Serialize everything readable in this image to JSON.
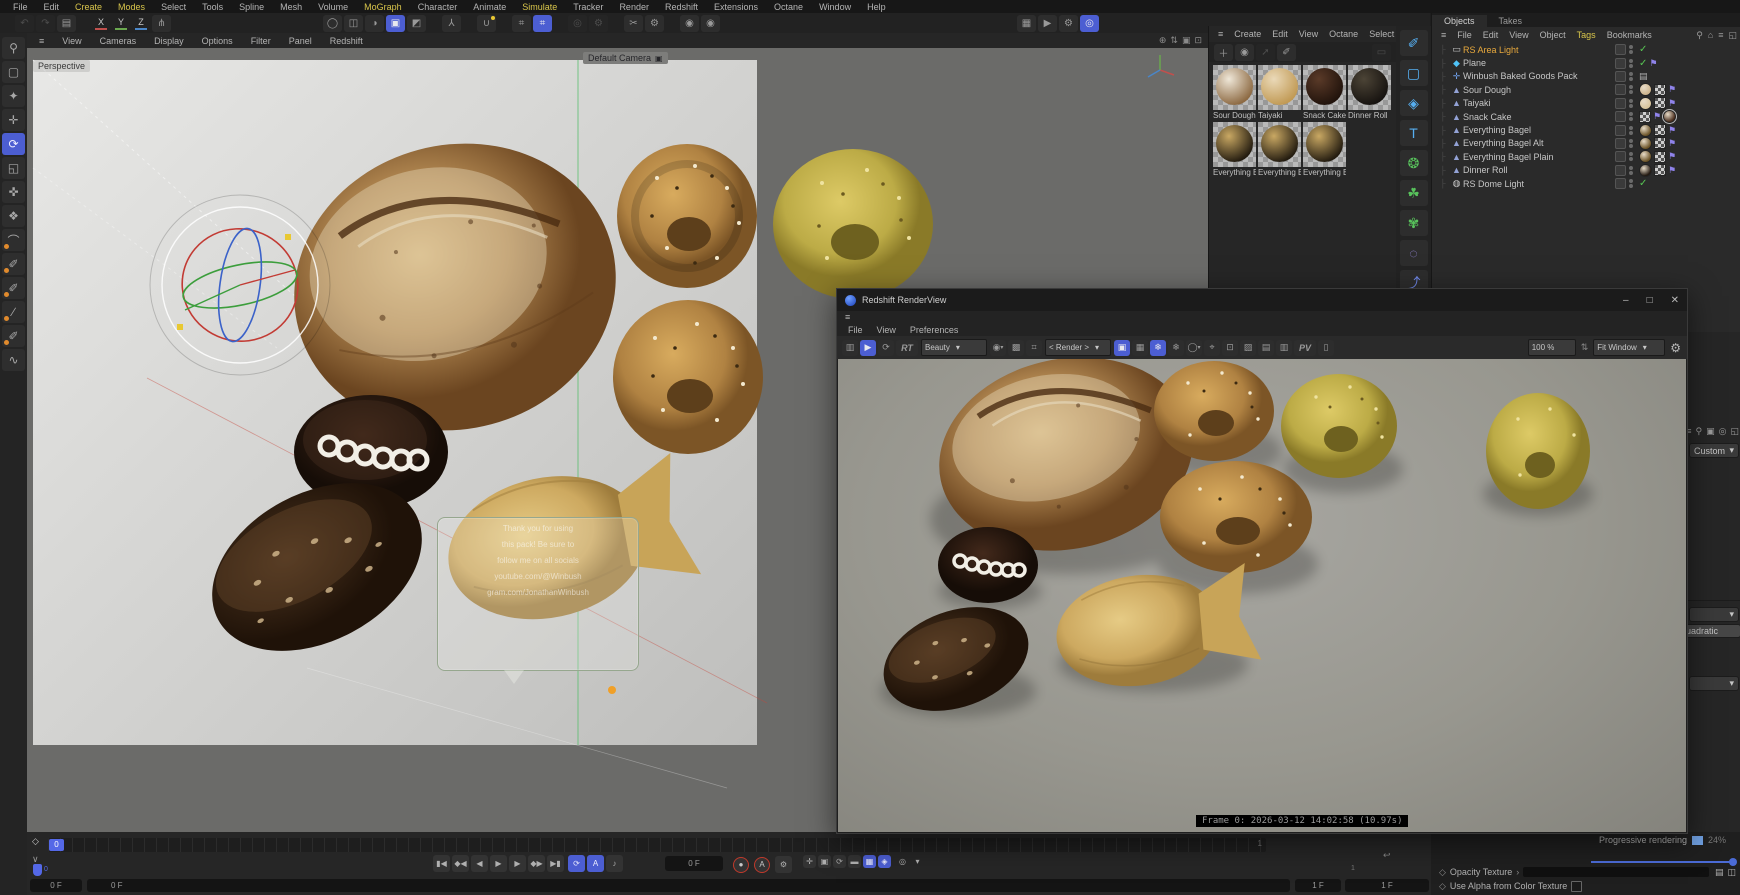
{
  "menubar": {
    "items": [
      {
        "label": "File"
      },
      {
        "label": "Edit"
      },
      {
        "label": "Create",
        "accent": true
      },
      {
        "label": "Modes",
        "accent": true
      },
      {
        "label": "Select"
      },
      {
        "label": "Tools"
      },
      {
        "label": "Spline"
      },
      {
        "label": "Mesh"
      },
      {
        "label": "Volume"
      },
      {
        "label": "MoGraph",
        "accent": true
      },
      {
        "label": "Character"
      },
      {
        "label": "Animate"
      },
      {
        "label": "Simulate",
        "accent": true
      },
      {
        "label": "Tracker"
      },
      {
        "label": "Render"
      },
      {
        "label": "Redshift"
      },
      {
        "label": "Extensions"
      },
      {
        "label": "Octane"
      },
      {
        "label": "Window"
      },
      {
        "label": "Help"
      }
    ]
  },
  "toolbar": {
    "left_icons": [
      {
        "n": "undo-icon",
        "g": "↶",
        "dim": true
      },
      {
        "n": "redo-icon",
        "g": "↷",
        "dim": true
      },
      {
        "n": "content-browser-icon",
        "g": "▤"
      }
    ],
    "xyz": [
      {
        "label": "X",
        "color": "#c0504d"
      },
      {
        "label": "Y",
        "color": "#6aa84f"
      },
      {
        "label": "Z",
        "color": "#4a86c8"
      }
    ],
    "coord_icon": {
      "n": "coordinate-system-icon",
      "g": "⋔"
    },
    "center_icons": [
      {
        "n": "make-editable-icon",
        "g": "◯"
      },
      {
        "n": "model-mode-icon",
        "g": "◫"
      },
      {
        "n": "texture-mode-icon",
        "g": "◑"
      },
      {
        "n": "object-mode-icon",
        "g": "▣",
        "active": true
      },
      {
        "n": "animation-mode-icon",
        "g": "◩"
      },
      {
        "sp": true
      },
      {
        "n": "character-tools-icon",
        "g": "⅄"
      },
      {
        "sp": true
      },
      {
        "n": "snap-icon",
        "g": "∪",
        "dot": "#e8c832"
      },
      {
        "sp": true
      },
      {
        "n": "workplane-icon",
        "g": "⌗"
      },
      {
        "n": "grid-snap-icon",
        "g": "⌗",
        "active": true
      },
      {
        "sp": true
      },
      {
        "n": "disabled-tool-icon",
        "g": "◎",
        "dim": true
      },
      {
        "n": "disabled-gear-icon",
        "g": "⚙",
        "dim": true
      },
      {
        "sp": true
      },
      {
        "n": "mirror-icon",
        "g": "✂"
      },
      {
        "n": "mirror-gear-icon",
        "g": "⚙"
      },
      {
        "sp": true
      },
      {
        "n": "axis-lock-icon",
        "g": "◉"
      },
      {
        "n": "axis-center-icon",
        "g": "◉"
      }
    ],
    "right_icons": [
      {
        "n": "render-view-icon",
        "g": "▦"
      },
      {
        "n": "render-pv-icon",
        "g": "▶"
      },
      {
        "n": "render-settings-icon",
        "g": "⚙"
      },
      {
        "n": "octane-live-icon",
        "g": "◎",
        "active": true
      }
    ]
  },
  "left_tools": [
    {
      "n": "search-icon",
      "g": "⚲"
    },
    {
      "n": "live-selection-icon",
      "g": "▢"
    },
    {
      "n": "tweak-icon",
      "g": "✦"
    },
    {
      "n": "move-icon",
      "g": "✛"
    },
    {
      "n": "rotate-icon",
      "g": "⟳",
      "active": true
    },
    {
      "n": "scale-icon",
      "g": "◱"
    },
    {
      "n": "axis-move-icon",
      "g": "✜"
    },
    {
      "n": "axis-modify-icon",
      "g": "❖"
    },
    {
      "n": "spline-smooth-icon",
      "g": "⌒",
      "o": true
    },
    {
      "n": "spline-pen-icon",
      "g": "✐",
      "o": true
    },
    {
      "n": "spline-point-icon",
      "g": "✐",
      "o": true
    },
    {
      "n": "measure-icon",
      "g": "∕",
      "o": true
    },
    {
      "n": "spline-arc-icon",
      "g": "✐",
      "o": true
    },
    {
      "n": "sketch-icon",
      "g": "∿"
    }
  ],
  "viewport": {
    "menu": [
      "View",
      "Cameras",
      "Display",
      "Options",
      "Filter",
      "Panel",
      "Redshift"
    ],
    "corner_icons": [
      {
        "n": "vp-pin-icon",
        "g": "⊕"
      },
      {
        "n": "vp-swap-icon",
        "g": "⇅"
      },
      {
        "n": "vp-maximize-icon",
        "g": "▣"
      },
      {
        "n": "vp-layout-icon",
        "g": "⊡"
      }
    ],
    "perspective_label": "Perspective",
    "camera_label": "Default Camera",
    "annotation_lines": [
      "Thank you for using",
      "this pack! Be sure to",
      "follow me on all socials",
      "youtube.com/@Winbush",
      "gram.com/JonathanWinbush"
    ]
  },
  "materials": {
    "menu": [
      "Create",
      "Edit",
      "View",
      "Octane",
      "Select",
      "›"
    ],
    "tools": [
      {
        "n": "add-material-icon",
        "g": "＋"
      },
      {
        "n": "material-ball-icon",
        "g": "◉"
      },
      {
        "n": "load-material-icon",
        "g": "➚",
        "dim": true
      },
      {
        "n": "eyedropper-icon",
        "g": "✐"
      }
    ],
    "trash_icon": {
      "n": "trash-icon",
      "g": "▭"
    },
    "items": [
      {
        "label": "Sour Dough",
        "hi": "#efe7d8",
        "lo": "#8d6a43"
      },
      {
        "label": "Taiyaki",
        "hi": "#ead9b8",
        "lo": "#c19a55"
      },
      {
        "label": "Snack Cake",
        "hi": "#5a3a28",
        "lo": "#21130c"
      },
      {
        "label": "Dinner Roll",
        "hi": "#4c4436",
        "lo": "#171310"
      },
      {
        "label": "Everything B",
        "hi": "#c9a863",
        "lo": "#241c10"
      },
      {
        "label": "Everything B",
        "hi": "#c9a863",
        "lo": "#241c10"
      },
      {
        "label": "Everything B",
        "hi": "#c9a863",
        "lo": "#241c10"
      }
    ]
  },
  "icon_strip": [
    {
      "n": "spline-pen-tool-icon",
      "g": "✐",
      "c": "#56aef0"
    },
    {
      "n": "rectangle-spline-icon",
      "g": "▢",
      "c": "#56aef0"
    },
    {
      "n": "cube-primitive-icon",
      "g": "◈",
      "c": "#56aef0"
    },
    {
      "n": "text-spline-icon",
      "g": "T",
      "c": "#56aef0"
    },
    {
      "n": "subdivision-surface-icon",
      "g": "❂",
      "c": "#58c25c"
    },
    {
      "n": "cloner-icon",
      "g": "☘",
      "c": "#58c25c"
    },
    {
      "n": "field-icon",
      "g": "✾",
      "c": "#58c25c"
    },
    {
      "n": "bend-deformer-icon",
      "g": "◌",
      "c": "#9a8ae0"
    },
    {
      "n": "xpresso-icon",
      "g": "⤴",
      "c": "#6f87e8"
    },
    {
      "n": "sound-icon",
      "g": "♪",
      "c": "#d07ad0"
    }
  ],
  "objects_panel": {
    "tabs": [
      {
        "label": "Objects",
        "on": true
      },
      {
        "label": "Takes"
      }
    ],
    "menu": [
      {
        "label": "File"
      },
      {
        "label": "Edit"
      },
      {
        "label": "View"
      },
      {
        "label": "Object"
      },
      {
        "label": "Tags",
        "accent": true
      },
      {
        "label": "Bookmarks"
      }
    ],
    "menu_icons": [
      {
        "n": "search-icon",
        "g": "⚲"
      },
      {
        "n": "home-icon",
        "g": "⌂"
      },
      {
        "n": "filter-icon",
        "g": "≡"
      },
      {
        "n": "popout-icon",
        "g": "◱"
      }
    ],
    "items": [
      {
        "label": "RS Area Light",
        "icon": "area-light",
        "color": "#e8a93d",
        "tags": [
          {
            "t": "check"
          }
        ]
      },
      {
        "label": "Plane",
        "icon": "plane",
        "tags": [
          {
            "t": "check"
          },
          {
            "t": "flag"
          }
        ]
      },
      {
        "label": "Winbush Baked Goods Pack",
        "icon": "null",
        "tags": [
          {
            "t": "note"
          }
        ]
      },
      {
        "label": "Sour Dough",
        "icon": "mesh",
        "tags": [
          {
            "t": "ball",
            "c": "#cdb48c"
          },
          {
            "t": "checker"
          },
          {
            "t": "flag"
          }
        ]
      },
      {
        "label": "Taiyaki",
        "icon": "mesh",
        "tags": [
          {
            "t": "ball",
            "c": "#d8c49b"
          },
          {
            "t": "checker"
          },
          {
            "t": "flag"
          }
        ]
      },
      {
        "label": "Snack Cake",
        "icon": "mesh",
        "tags": [
          {
            "t": "checker"
          },
          {
            "t": "flag"
          },
          {
            "t": "ball",
            "c": "#4a2e1e",
            "sel": true
          }
        ]
      },
      {
        "label": "Everything Bagel",
        "icon": "mesh",
        "tags": [
          {
            "t": "ball",
            "c": "#6b5327"
          },
          {
            "t": "checker"
          },
          {
            "t": "flag"
          }
        ]
      },
      {
        "label": "Everything Bagel Alt",
        "icon": "mesh",
        "tags": [
          {
            "t": "ball",
            "c": "#6b5327"
          },
          {
            "t": "checker"
          },
          {
            "t": "flag"
          }
        ]
      },
      {
        "label": "Everything Bagel  Plain",
        "icon": "mesh",
        "tags": [
          {
            "t": "ball",
            "c": "#6b5327"
          },
          {
            "t": "checker"
          },
          {
            "t": "flag"
          }
        ]
      },
      {
        "label": "Dinner Roll",
        "icon": "mesh",
        "tags": [
          {
            "t": "ball",
            "c": "#241a12"
          },
          {
            "t": "checker"
          },
          {
            "t": "flag"
          }
        ]
      },
      {
        "label": "RS Dome Light",
        "icon": "dome-light",
        "tags": [
          {
            "t": "check"
          }
        ]
      }
    ],
    "icon_glyphs": {
      "area-light": [
        "▭",
        "#c8c8c8"
      ],
      "plane": [
        "◆",
        "#4fc3f7"
      ],
      "null": [
        "✛",
        "#6f9fe8"
      ],
      "mesh": [
        "▲",
        "#93a2d6"
      ],
      "dome-light": [
        "◍",
        "#c8c8c8"
      ]
    }
  },
  "attr_sliver": {
    "icons": [
      {
        "n": "attr-mode-icon",
        "g": "≡"
      },
      {
        "n": "attr-search-icon",
        "g": "⚲"
      },
      {
        "n": "attr-lock-icon",
        "g": "▣"
      },
      {
        "n": "attr-target-icon",
        "g": "◎"
      },
      {
        "n": "attr-popout-icon",
        "g": "◱"
      }
    ],
    "custom": "Custom",
    "quadratic": "uadratic"
  },
  "renderview": {
    "title": "Redshift RenderView",
    "window_buttons": [
      {
        "n": "minimize-button",
        "g": "–"
      },
      {
        "n": "maximize-button",
        "g": "□"
      },
      {
        "n": "close-button",
        "g": "✕"
      }
    ],
    "menu": [
      "File",
      "View",
      "Preferences"
    ],
    "toolbar": [
      {
        "n": "snapshot-icon",
        "g": "▥"
      },
      {
        "n": "start-render-icon",
        "g": "▶",
        "active": true
      },
      {
        "n": "restart-render-icon",
        "g": "⟳"
      },
      {
        "n": "rt-toggle",
        "g": "RT",
        "wide": true
      },
      {
        "sel": "Beauty",
        "n": "aov-select"
      },
      {
        "n": "channel-rgb-icon",
        "g": "◉",
        "dd": true
      },
      {
        "n": "pixel-grid-icon",
        "g": "▩"
      },
      {
        "n": "crop-icon",
        "g": "⌗"
      },
      {
        "sel": "< Render >",
        "n": "render-mode-select"
      },
      {
        "n": "lock-render-icon",
        "g": "▣",
        "active": true
      },
      {
        "n": "bucket-grid-icon",
        "g": "▦"
      },
      {
        "n": "snapshot-a-icon",
        "g": "❄",
        "active": true
      },
      {
        "n": "snapshot-b-icon",
        "g": "❄"
      },
      {
        "n": "compare-icon",
        "g": "◯",
        "dd": true
      },
      {
        "n": "focus-pick-icon",
        "g": "⌖"
      },
      {
        "n": "region-pick-icon",
        "g": "⊡"
      },
      {
        "n": "diagnostics-icon",
        "g": "▨"
      },
      {
        "n": "save-image-icon",
        "g": "▤"
      },
      {
        "n": "save-image-plus-icon",
        "g": "▥"
      },
      {
        "n": "to-pv-icon",
        "g": "PV",
        "wide": true
      },
      {
        "n": "copy-image-icon",
        "g": "▯"
      }
    ],
    "zoom": "100 %",
    "fit": "Fit Window",
    "status": "Frame 0:  2026-03-12  14:02:58  (10.97s)"
  },
  "timeline": {
    "scrub": "0",
    "range_end_mark": "1",
    "transport": [
      {
        "n": "goto-start-button",
        "g": "▮◀"
      },
      {
        "n": "prev-key-button",
        "g": "◆◀"
      },
      {
        "n": "prev-frame-button",
        "g": "◀"
      },
      {
        "n": "play-button",
        "g": "▶"
      },
      {
        "n": "next-frame-button",
        "g": "▶"
      },
      {
        "n": "next-key-button",
        "g": "◆▶"
      },
      {
        "n": "goto-end-button",
        "g": "▶▮"
      }
    ],
    "toggles": [
      {
        "n": "loop-button",
        "g": "⟳",
        "active": true
      },
      {
        "n": "autokey-range-button",
        "g": "A",
        "active": true
      },
      {
        "n": "sound-button",
        "g": "♪"
      }
    ],
    "current_frame": "0 F",
    "record": [
      {
        "n": "record-button",
        "g": "●",
        "ring": true
      },
      {
        "n": "autokey-button",
        "g": "A",
        "ring": true
      },
      {
        "n": "keyframe-settings-icon",
        "g": "⚙"
      }
    ],
    "key_icons": [
      {
        "n": "key-position-icon",
        "g": "✛"
      },
      {
        "n": "key-scale-icon",
        "g": "▣"
      },
      {
        "n": "key-rotation-icon",
        "g": "⟳"
      },
      {
        "n": "key-parameter-icon",
        "g": "▬"
      },
      {
        "n": "key-pla-icon",
        "g": "▦",
        "active": true
      },
      {
        "n": "key-auto-icon",
        "g": "◈",
        "active": true
      }
    ],
    "extra_icons": [
      {
        "n": "solo-icon",
        "g": "◎"
      },
      {
        "n": "solo-menu-icon",
        "g": "▾"
      }
    ],
    "start_field": "0 F",
    "range_start_label": "0 F",
    "minor_mark": "1",
    "end_field_1": "1 F",
    "end_field_2": "1 F"
  },
  "bottom_attrs": {
    "progressive_label": "Progressive rendering",
    "progress": "24%",
    "rows": [
      {
        "label": "Opacity Texture",
        "arrow": "›",
        "field": true
      },
      {
        "label": "Use Alpha from Color Texture",
        "checkbox": true
      }
    ]
  },
  "scene": {
    "objects": [
      "sourdough-bread",
      "everything-bagel",
      "everything-bagel-alt",
      "everything-bagel-plain",
      "snack-cake",
      "chocolate-loaf",
      "taiyaki"
    ],
    "colors": {
      "accent_blue": "#4c5ed2",
      "menu_yellow": "#d8c54b",
      "selected_orange": "#e8a93d",
      "check_green": "#57c553",
      "tag_violet": "#8f83ea"
    }
  }
}
